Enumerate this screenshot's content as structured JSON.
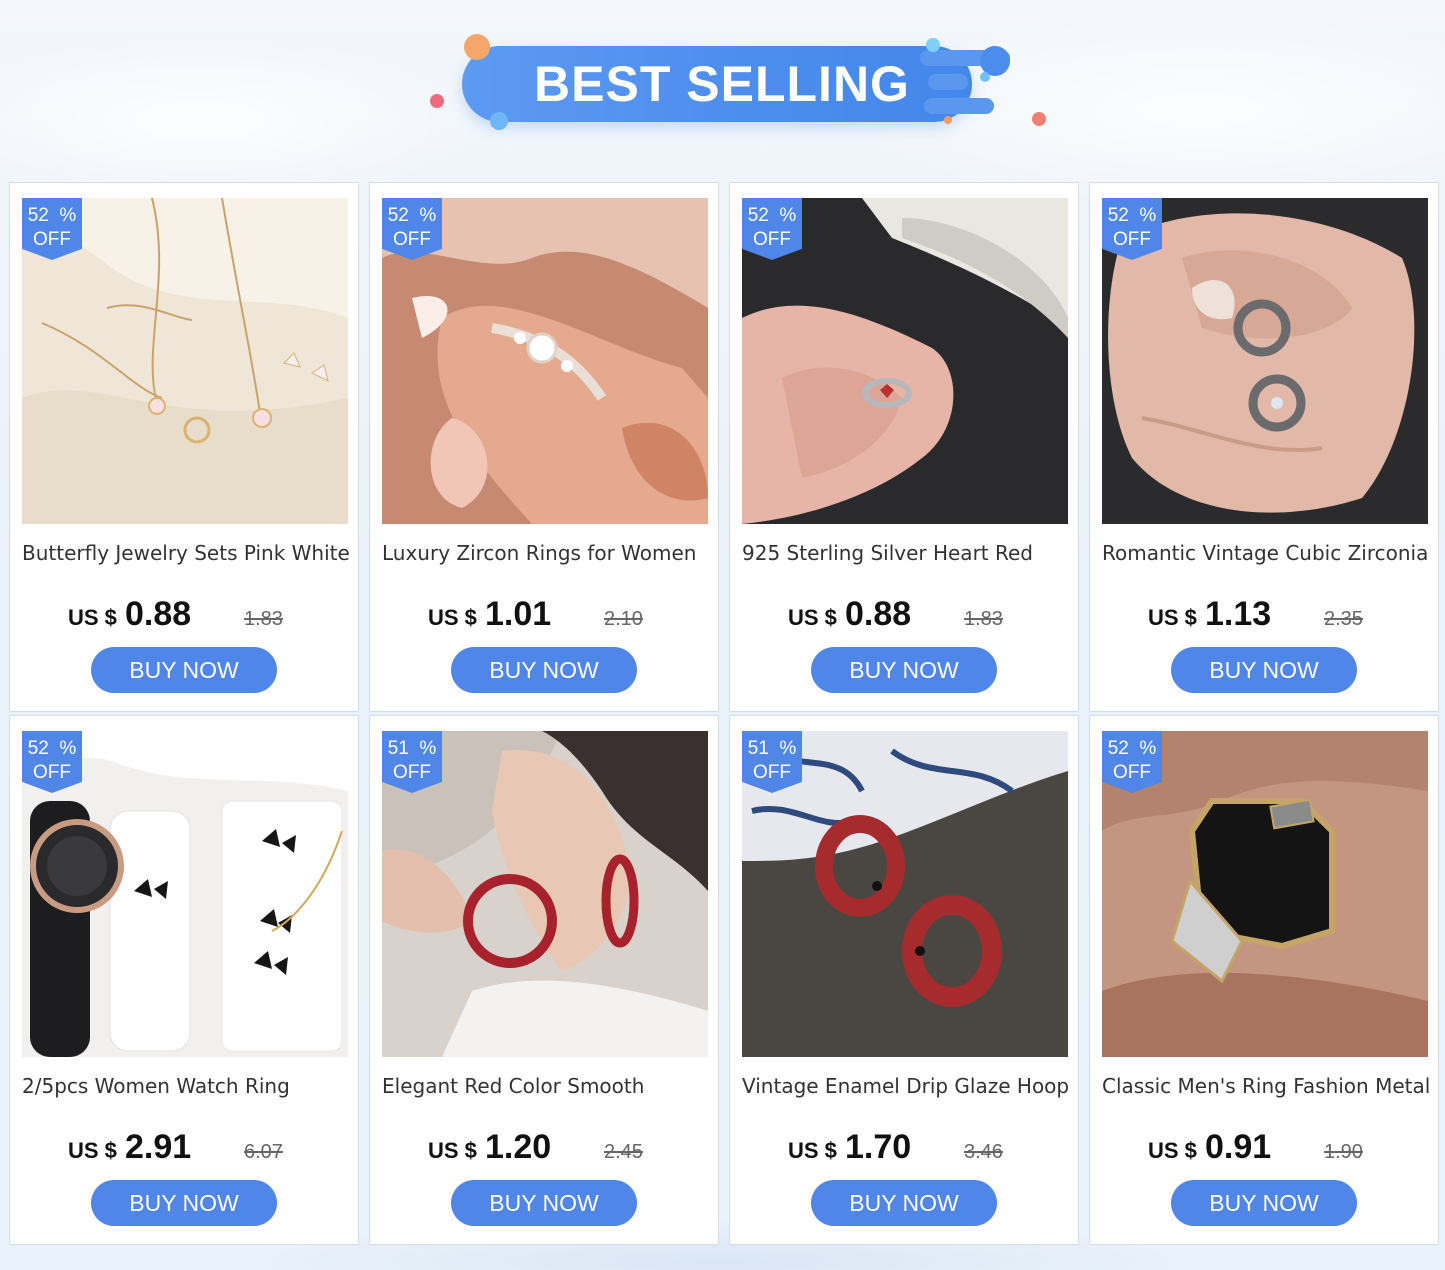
{
  "banner": {
    "title": "BEST SELLING"
  },
  "products": [
    {
      "title": "Butterfly Jewelry Sets Pink White",
      "discount_value": "52  %",
      "discount_label": "OFF",
      "currency": "US $",
      "price": "0.88",
      "original_price": "1.83",
      "button_label": "BUY NOW",
      "image": "butterfly-jewelry-set-photo"
    },
    {
      "title": "Luxury Zircon Rings for Women",
      "discount_value": "52  %",
      "discount_label": "OFF",
      "currency": "US $",
      "price": "1.01",
      "original_price": "2.10",
      "button_label": "BUY NOW",
      "image": "zircon-ring-on-finger-photo"
    },
    {
      "title": "925 Sterling Silver Heart Red",
      "discount_value": "52  %",
      "discount_label": "OFF",
      "currency": "US $",
      "price": "0.88",
      "original_price": "1.83",
      "button_label": "BUY NOW",
      "image": "silver-heart-ring-photo"
    },
    {
      "title": "Romantic Vintage Cubic Zirconia",
      "discount_value": "52  %",
      "discount_label": "OFF",
      "currency": "US $",
      "price": "1.13",
      "original_price": "2.35",
      "button_label": "BUY NOW",
      "image": "vintage-rings-on-hand-photo"
    },
    {
      "title": "2/5pcs Women Watch Ring",
      "discount_value": "52  %",
      "discount_label": "OFF",
      "currency": "US $",
      "price": "2.91",
      "original_price": "6.07",
      "button_label": "BUY NOW",
      "image": "watch-and-butterfly-set-photo"
    },
    {
      "title": "Elegant Red Color Smooth",
      "discount_value": "51  %",
      "discount_label": "OFF",
      "currency": "US $",
      "price": "1.20",
      "original_price": "2.45",
      "button_label": "BUY NOW",
      "image": "red-hoop-earrings-photo"
    },
    {
      "title": "Vintage Enamel Drip Glaze Hoop",
      "discount_value": "51  %",
      "discount_label": "OFF",
      "currency": "US $",
      "price": "1.70",
      "original_price": "3.46",
      "button_label": "BUY NOW",
      "image": "enamel-hoop-earrings-photo"
    },
    {
      "title": "Classic Men's Ring Fashion Metal",
      "discount_value": "52  %",
      "discount_label": "OFF",
      "currency": "US $",
      "price": "0.91",
      "original_price": "1.90",
      "button_label": "BUY NOW",
      "image": "mens-black-ring-photo"
    }
  ],
  "colors": {
    "accent": "#4f86e7",
    "banner": "#4d8ded",
    "card_bg": "#ffffff",
    "page_bg": "#eaf2fb"
  }
}
